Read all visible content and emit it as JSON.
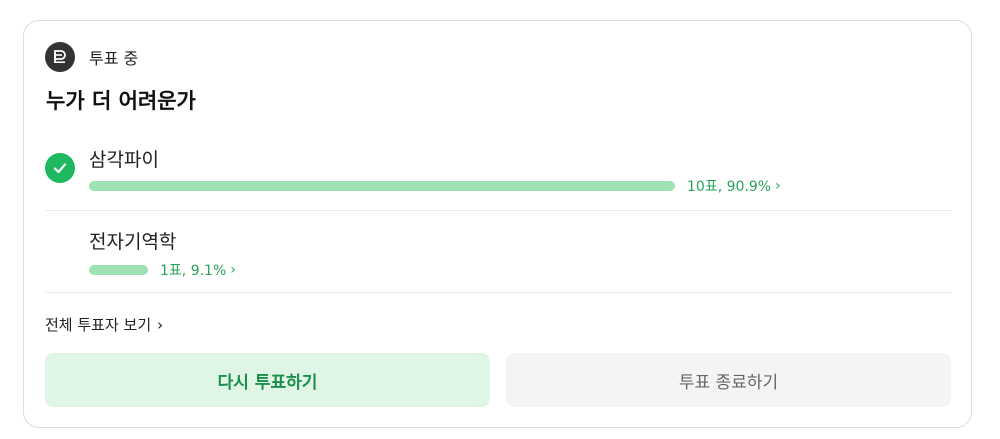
{
  "poll": {
    "status_label": "투표 중",
    "question": "누가 더 어려운가",
    "options": [
      {
        "label": "삼각파이",
        "votes_text": "10표, 90.9%",
        "fraction": 0.909,
        "selected": true
      },
      {
        "label": "전자기역학",
        "votes_text": "1표, 9.1%",
        "fraction": 0.091,
        "selected": false
      }
    ],
    "all_voters_label": "전체 투표자 보기",
    "revote_label": "다시 투표하기",
    "end_vote_label": "투표 종료하기"
  },
  "colors": {
    "accent": "#1fb85e",
    "bar": "#9ee2b4",
    "result_text": "#2aa35a"
  },
  "icons": [
    "poll-icon",
    "check-icon",
    "chevron-right-icon"
  ]
}
